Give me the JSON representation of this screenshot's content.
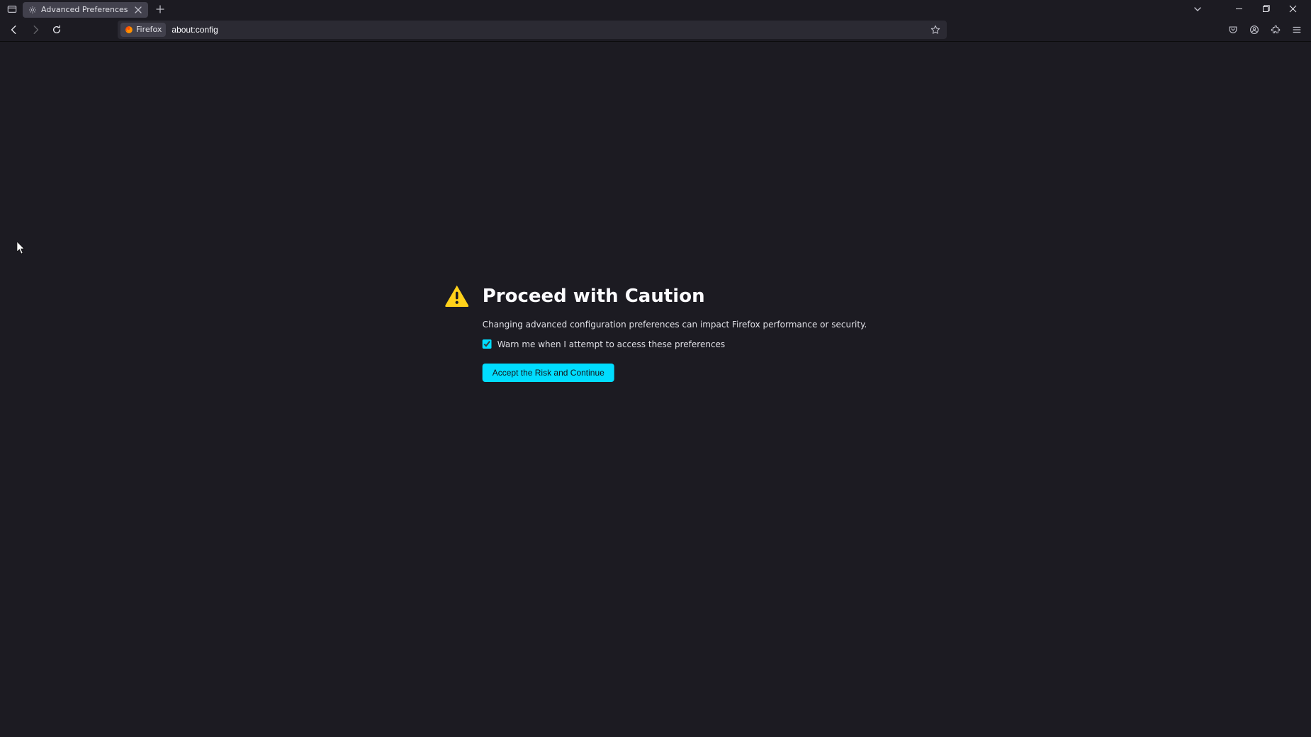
{
  "tab": {
    "title": "Advanced Preferences"
  },
  "urlbar": {
    "identity_label": "Firefox",
    "address": "about:config"
  },
  "warning": {
    "title": "Proceed with Caution",
    "description": "Changing advanced configuration preferences can impact Firefox performance or security.",
    "checkbox_label": "Warn me when I attempt to access these preferences",
    "button_label": "Accept the Risk and Continue"
  }
}
